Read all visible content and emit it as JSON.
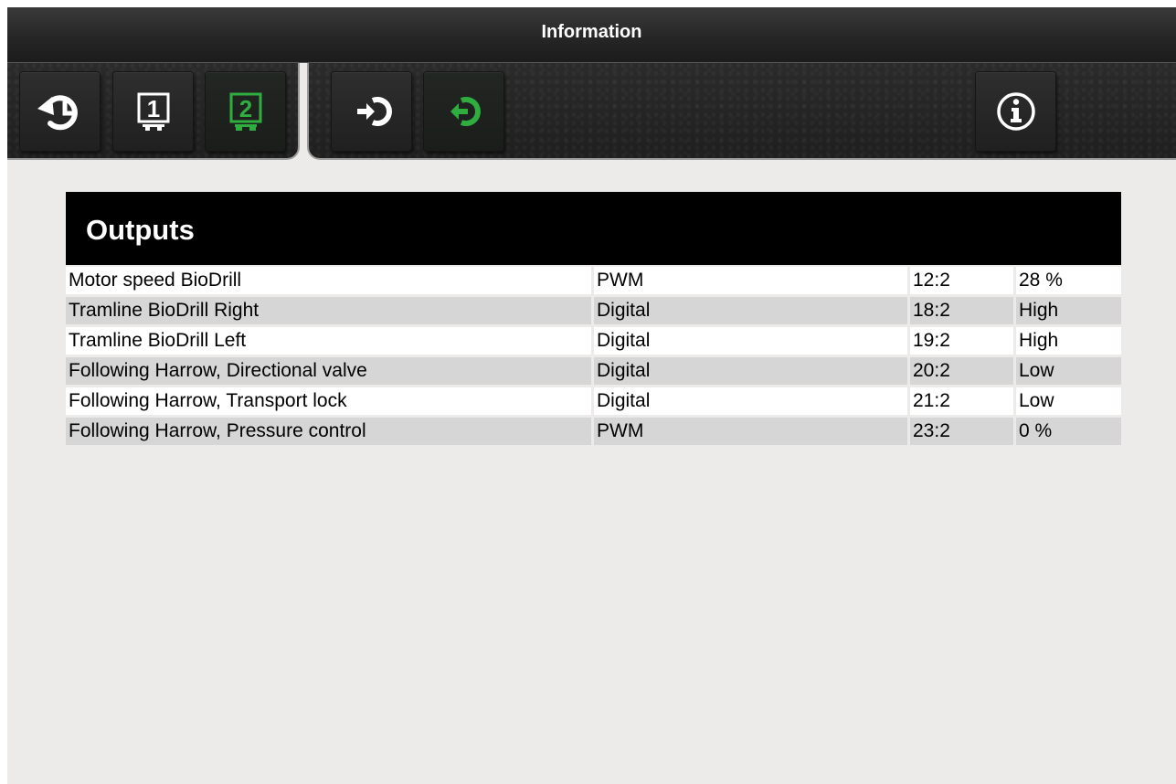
{
  "header": {
    "title": "Information"
  },
  "toolbar": {
    "buttons": [
      {
        "icon": "history-icon",
        "active": false
      },
      {
        "icon": "screen-1-icon",
        "label": "1",
        "active": false
      },
      {
        "icon": "screen-2-icon",
        "label": "2",
        "active": true
      },
      {
        "icon": "input-icon",
        "active": false
      },
      {
        "icon": "output-icon",
        "active": true
      },
      {
        "icon": "info-icon",
        "active": false
      }
    ],
    "accent_color": "#2fae3f"
  },
  "outputs": {
    "title": "Outputs",
    "rows": [
      {
        "name": "Motor speed BioDrill",
        "type": "PWM",
        "pin": "12:2",
        "value": "28 %"
      },
      {
        "name": "Tramline BioDrill Right",
        "type": "Digital",
        "pin": "18:2",
        "value": "High"
      },
      {
        "name": "Tramline BioDrill Left",
        "type": "Digital",
        "pin": "19:2",
        "value": "High"
      },
      {
        "name": "Following Harrow, Directional valve",
        "type": "Digital",
        "pin": "20:2",
        "value": "Low"
      },
      {
        "name": "Following Harrow, Transport lock",
        "type": "Digital",
        "pin": "21:2",
        "value": "Low"
      },
      {
        "name": "Following Harrow, Pressure control",
        "type": "PWM",
        "pin": "23:2",
        "value": "0 %"
      }
    ]
  }
}
